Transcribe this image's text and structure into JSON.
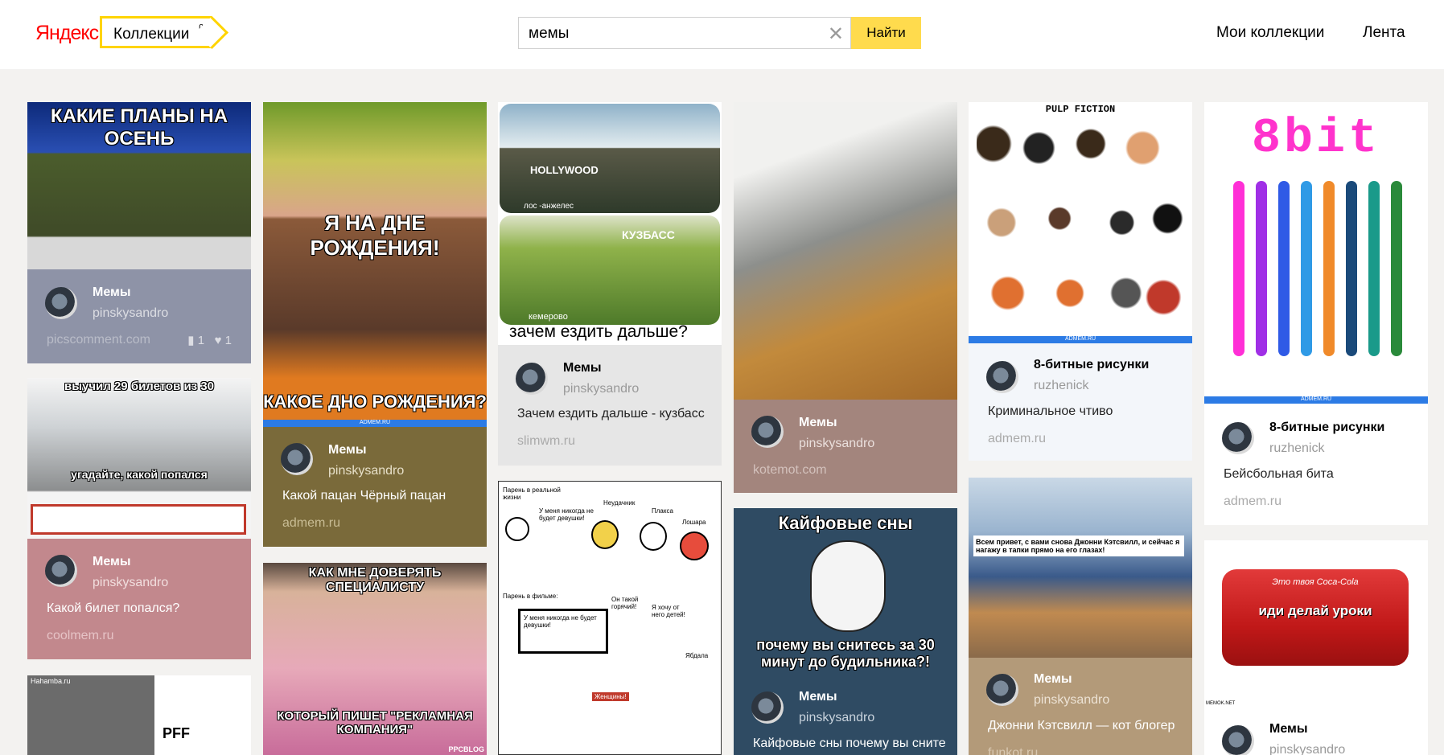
{
  "header": {
    "logo": "Яндекс",
    "collections_label": "Коллекции",
    "beta": "β",
    "search_value": "мемы",
    "search_button": "Найти",
    "nav": [
      "Мои коллекции",
      "Лента"
    ]
  },
  "cards": [
    {
      "overlay_top": "КАКИЕ ПЛАНЫ НА ОСЕНЬ",
      "collection": "Мемы",
      "user": "pinskysandro",
      "source": "picscomment.com",
      "bookmarks": "1",
      "likes": "1"
    },
    {
      "overlay_top": "выучил 29 билетов из 30",
      "overlay_bottom": "угадайте, какой попался",
      "collection": "Мемы",
      "user": "pinskysandro",
      "title": "Какой билет попался?",
      "source": "coolmem.ru"
    },
    {
      "overlay_top": "Hahamba.ru",
      "overlay_bottom": "PFF"
    },
    {
      "overlay_top": "Я НА ДНЕ РОЖДЕНИЯ!",
      "overlay_bottom": "КАКОЕ ДНО РОЖДЕНИЯ?",
      "watermark": "ADMEM.RU",
      "collection": "Мемы",
      "user": "pinskysandro",
      "title": "Какой пацан Чёрный пацан",
      "source": "admem.ru"
    },
    {
      "overlay_top": "КАК МНЕ ДОВЕРЯТЬ СПЕЦИАЛИСТУ",
      "overlay_bottom": "КОТОРЫЙ ПИШЕТ \"РЕКЛАМНАЯ КОМПАНИЯ\"",
      "watermark": "PPCBLOG"
    },
    {
      "overlay_top": "HOLLYWOOD",
      "caption1": "лос -анжелес",
      "overlay_mid": "КУЗБАСС",
      "caption2": "кемерово",
      "overlay_bottom": "зачем ездить дальше?",
      "collection": "Мемы",
      "user": "pinskysandro",
      "title": "Зачем ездить дальше - кузбасс",
      "source": "slimwm.ru"
    },
    {
      "comic": [
        "Парень в реальной жизни",
        "У меня никогда не будет девушки!",
        "Неудачник",
        "Плакса",
        "Лошара",
        "Парень в фильме:",
        "У меня никогда не будет девушки!",
        "Он такой горячий!",
        "Я хочу от него детей!",
        "Ябдала",
        "Женщины!"
      ]
    },
    {
      "collection": "Мемы",
      "user": "pinskysandro",
      "source": "kotemot.com"
    },
    {
      "overlay_top": "Кайфовые сны",
      "overlay_bottom": "почему вы снитесь за 30 минут до будильника?!",
      "collection": "Мемы",
      "user": "pinskysandro",
      "title": "Кайфовые сны почему вы снитесь",
      "source": ""
    },
    {
      "overlay_top": "PULP FICTION",
      "watermark": "ADMEM.RU",
      "collection": "8-битные рисунки",
      "user": "ruzhenick",
      "title": "Криминальное чтиво",
      "source": "admem.ru"
    },
    {
      "overlay_top": "Всем привет, с вами снова Джонни Кэтсвилл, и сейчас я нагажу в тапки прямо на его глазах!",
      "collection": "Мемы",
      "user": "pinskysandro",
      "title": "Джонни Кэтсвилл — кот блогер",
      "source": "funkot.ru"
    },
    {
      "overlay_top": "8bit",
      "watermark": "ADMEM.RU",
      "collection": "8-битные рисунки",
      "user": "ruzhenick",
      "title": "Бейсбольная бита",
      "source": "admem.ru"
    },
    {
      "overlay_top": "Это твоя Coca-Cola",
      "overlay_bottom": "иди делай уроки",
      "watermark": "MEMOK.NET",
      "collection": "Мемы",
      "user": "pinskysandro"
    }
  ],
  "colors": {
    "accent": "#ffdb4d",
    "brand_border": "#ffd400"
  }
}
